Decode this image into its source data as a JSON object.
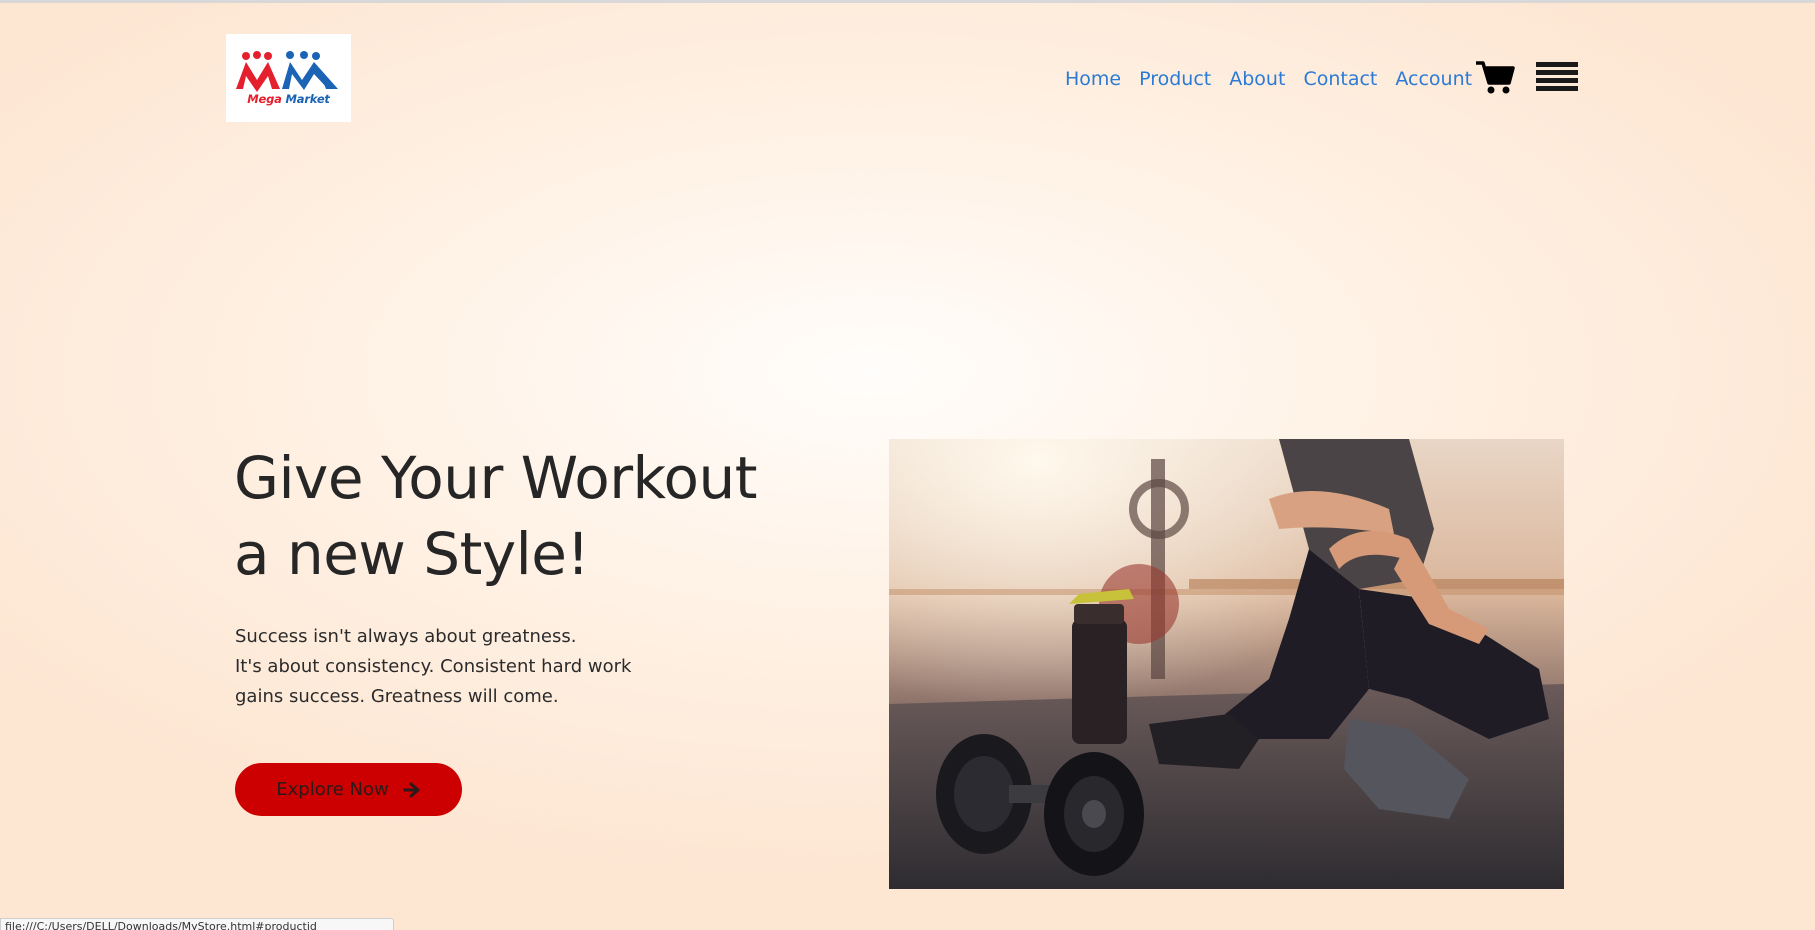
{
  "logo": {
    "word1": "Mega",
    "word2": "Market",
    "red": "#e4202f",
    "blue": "#1b63b5"
  },
  "nav": {
    "items": [
      {
        "label": "Home"
      },
      {
        "label": "Product"
      },
      {
        "label": "About"
      },
      {
        "label": "Contact"
      },
      {
        "label": "Account"
      }
    ],
    "link_color": "#2b7bd6",
    "cart_icon": "shopping-cart-icon",
    "menu_icon": "hamburger-menu-icon"
  },
  "hero": {
    "title_line1": "Give Your Workout",
    "title_line2": "a new Style!",
    "sub_line1": "Success isn't always about greatness.",
    "sub_line2": "It's about consistency. Consistent hard work",
    "sub_line3": "gains success. Greatness will come.",
    "button_label": "Explore Now",
    "button_icon": "arrow-right-icon",
    "button_color": "#cc0000",
    "image_alt": "woman sitting on gym floor beside dumbbells and a shaker bottle"
  },
  "status_bar": {
    "url": "file:///C:/Users/DELL/Downloads/MyStore.html#productid"
  }
}
